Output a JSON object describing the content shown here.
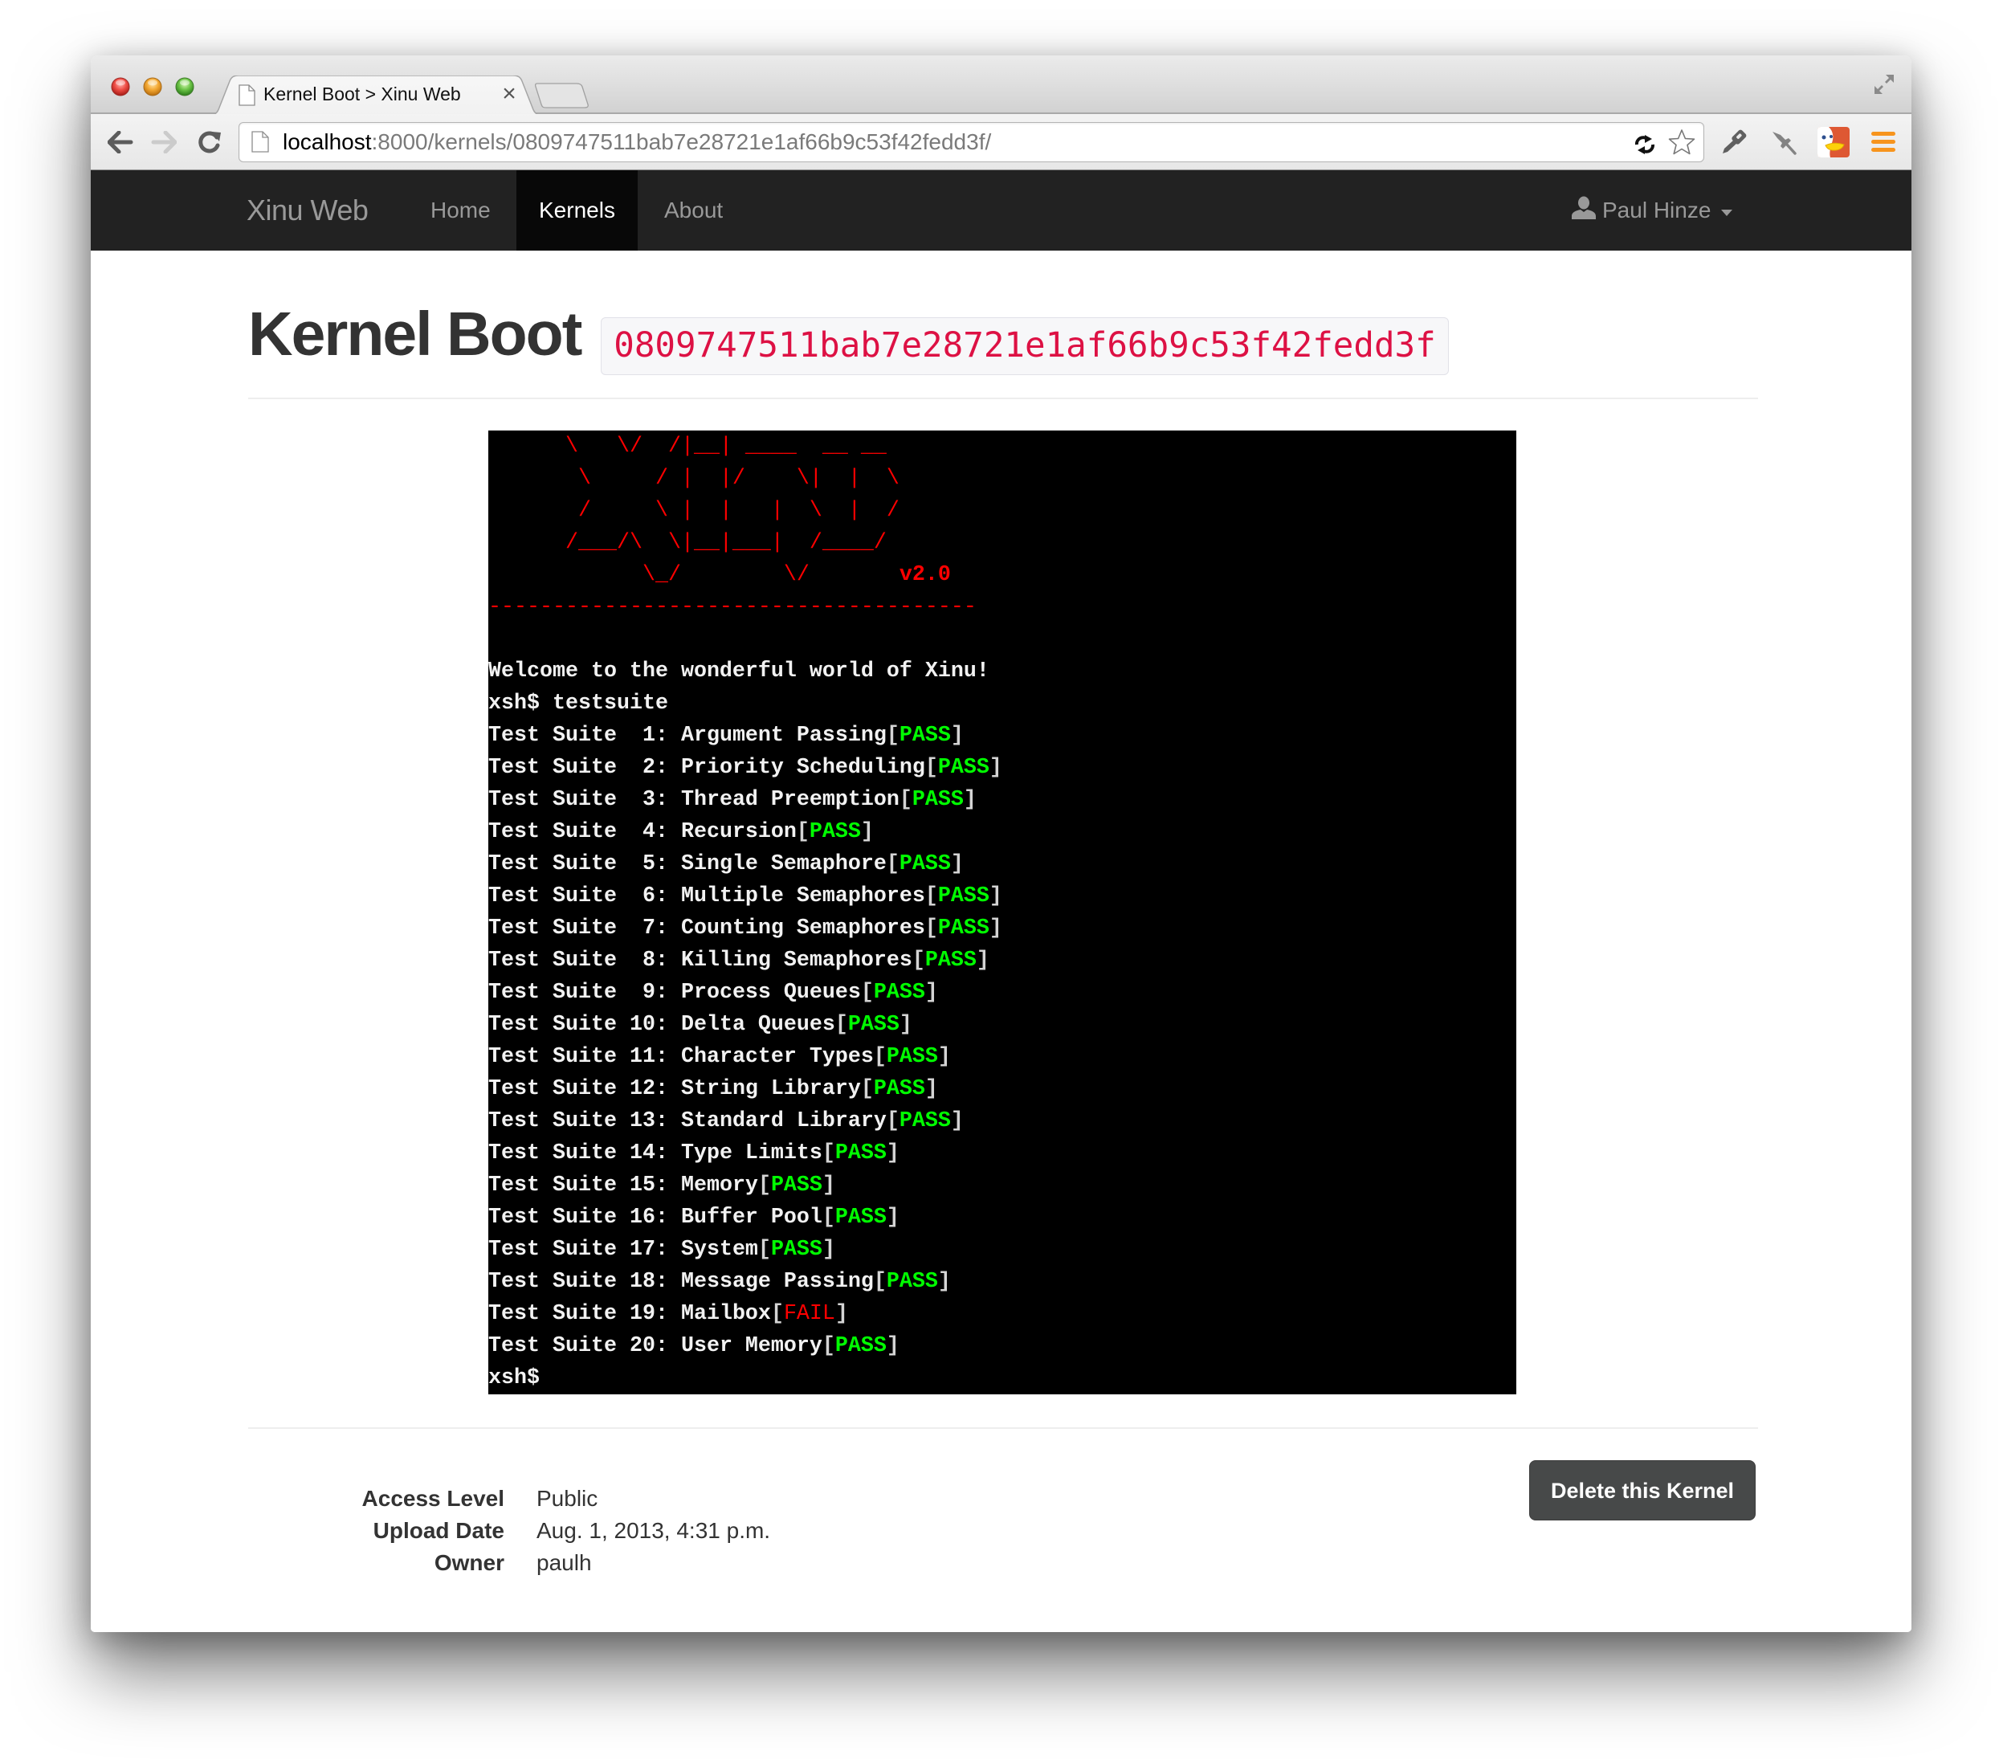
{
  "browser": {
    "tab_title": "Kernel Boot > Xinu Web",
    "tab_close": "×",
    "url_host": "localhost",
    "url_path": ":8000/kernels/0809747511bab7e28721e1af66b9c53f42fedd3f/"
  },
  "icons": {
    "window_controls": [
      "close-light-icon",
      "minimize-light-icon",
      "zoom-light-icon"
    ],
    "toolbar": [
      "back-arrow-icon",
      "forward-arrow-icon",
      "reload-icon",
      "page-icon",
      "sync-icon",
      "bookmark-star-icon",
      "key-icon",
      "pin-icon",
      "duckduckgo-icon",
      "menu-icon",
      "fullscreen-icon"
    ],
    "navbar": [
      "user-icon",
      "caret-down-icon"
    ]
  },
  "navbar": {
    "brand": "Xinu Web",
    "items": [
      {
        "label": "Home",
        "active": false
      },
      {
        "label": "Kernels",
        "active": true
      },
      {
        "label": "About",
        "active": false
      }
    ],
    "user": "Paul Hinze"
  },
  "page": {
    "title": "Kernel Boot",
    "kernel_id": "0809747511bab7e28721e1af66b9c53f42fedd3f"
  },
  "terminal": {
    "logo_lines": [
      "      \\   \\/  /|__| ____  __ __",
      "       \\     / |  |/    \\|  |  \\",
      "       /     \\ |  |   |  \\  |  /",
      "      /___/\\  \\|__|___|  /____/",
      "            \\_/        \\/       "
    ],
    "version": "v2.0",
    "separator": "--------------------------------------",
    "welcome": "Welcome to the wonderful world of Xinu!",
    "prompt": "xsh$",
    "command": "testsuite",
    "test_label": "Test Suite",
    "tests": [
      {
        "number": 1,
        "name": "Argument Passing",
        "result": "PASS"
      },
      {
        "number": 2,
        "name": "Priority Scheduling",
        "result": "PASS"
      },
      {
        "number": 3,
        "name": "Thread Preemption",
        "result": "PASS"
      },
      {
        "number": 4,
        "name": "Recursion",
        "result": "PASS"
      },
      {
        "number": 5,
        "name": "Single Semaphore",
        "result": "PASS"
      },
      {
        "number": 6,
        "name": "Multiple Semaphores",
        "result": "PASS"
      },
      {
        "number": 7,
        "name": "Counting Semaphores",
        "result": "PASS"
      },
      {
        "number": 8,
        "name": "Killing Semaphores",
        "result": "PASS"
      },
      {
        "number": 9,
        "name": "Process Queues",
        "result": "PASS"
      },
      {
        "number": 10,
        "name": "Delta Queues",
        "result": "PASS"
      },
      {
        "number": 11,
        "name": "Character Types",
        "result": "PASS"
      },
      {
        "number": 12,
        "name": "String Library",
        "result": "PASS"
      },
      {
        "number": 13,
        "name": "Standard Library",
        "result": "PASS"
      },
      {
        "number": 14,
        "name": "Type Limits",
        "result": "PASS"
      },
      {
        "number": 15,
        "name": "Memory",
        "result": "PASS"
      },
      {
        "number": 16,
        "name": "Buffer Pool",
        "result": "PASS"
      },
      {
        "number": 17,
        "name": "System",
        "result": "PASS"
      },
      {
        "number": 18,
        "name": "Message Passing",
        "result": "PASS"
      },
      {
        "number": 19,
        "name": "Mailbox",
        "result": "FAIL"
      },
      {
        "number": 20,
        "name": "User Memory",
        "result": "PASS"
      }
    ]
  },
  "details": {
    "fields": [
      {
        "label": "Access Level",
        "value": "Public"
      },
      {
        "label": "Upload Date",
        "value": "Aug. 1, 2013, 4:31 p.m."
      },
      {
        "label": "Owner",
        "value": "paulh"
      }
    ]
  },
  "actions": {
    "delete_label": "Delete this Kernel"
  },
  "colors": {
    "navbar_bg": "#222222",
    "navbar_active_bg": "#080808",
    "code_text": "#dd1144",
    "terminal_bg": "#000000",
    "terminal_logo": "#ff0000",
    "pass": "#00ff00",
    "fail": "#ff0000",
    "delete_button": "#474949",
    "menu_orange": "#f7941d"
  }
}
